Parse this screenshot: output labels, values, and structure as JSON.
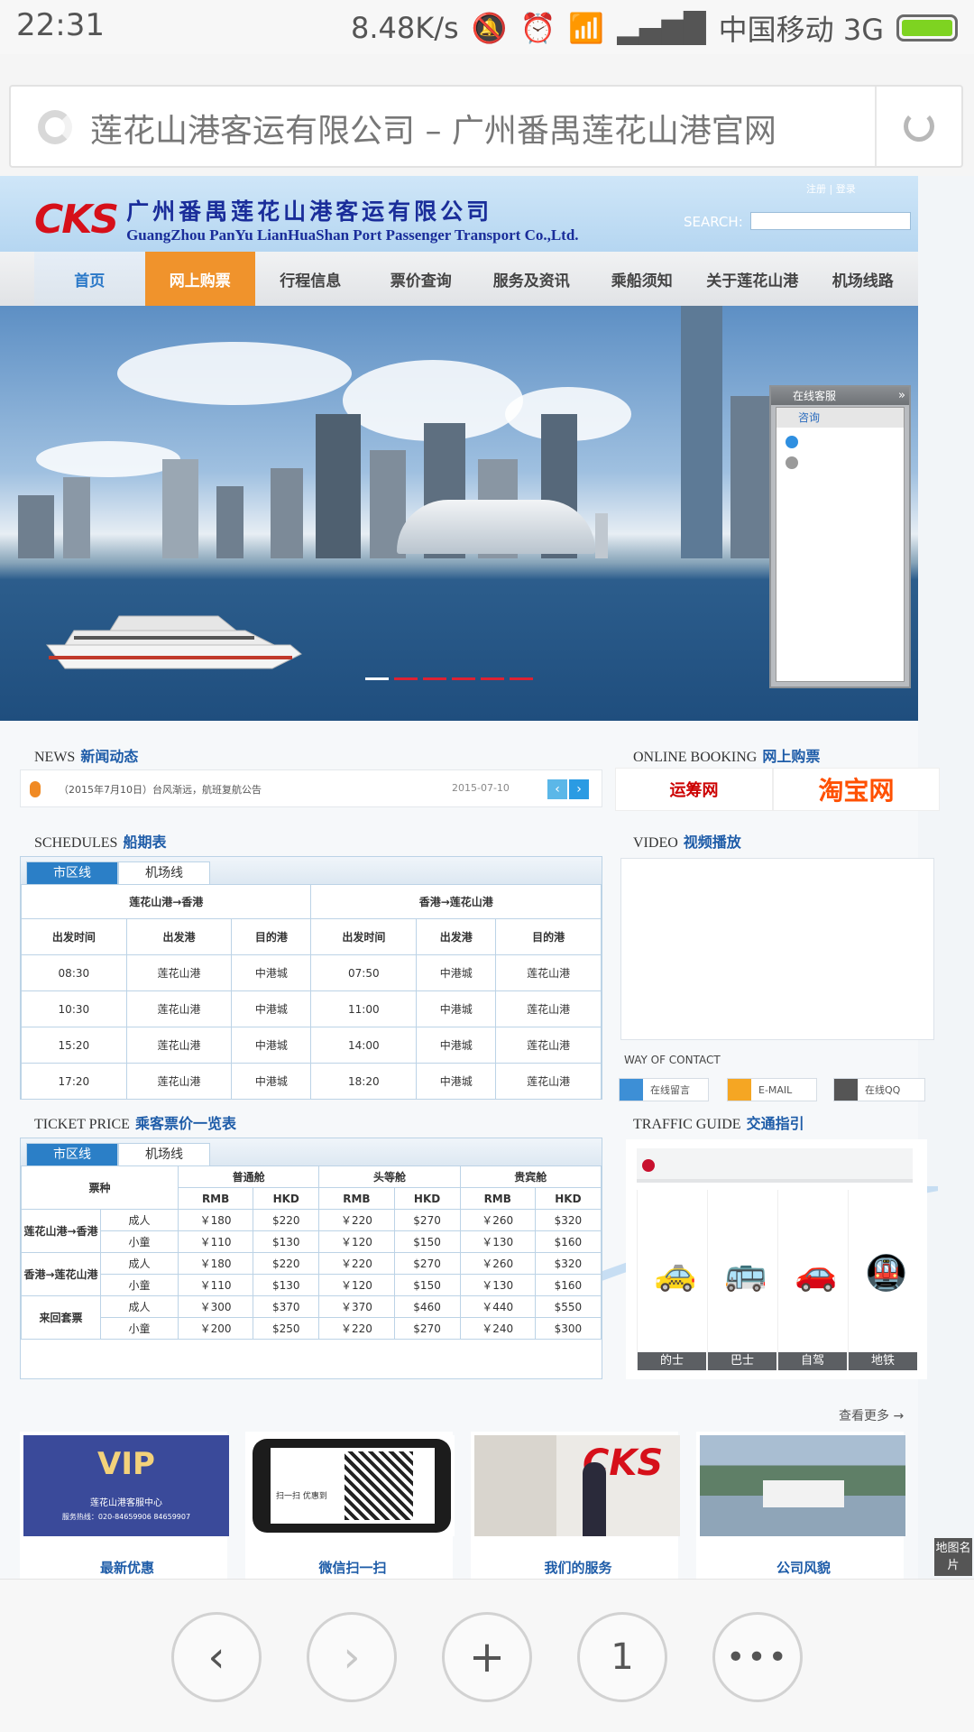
{
  "status_bar": {
    "time": "22:31",
    "speed": "8.48K/s",
    "carrier": "中国移动 3G"
  },
  "browser": {
    "page_title": "莲花山港客运有限公司 – 广州番禺莲花山港官网",
    "tabs_count": "1"
  },
  "site": {
    "logo_mark": "CKS",
    "name_cn": "广州番禺莲花山港客运有限公司",
    "name_en": "GuangZhou PanYu LianHuaShan Port Passenger Transport Co.,Ltd.",
    "login_links": "注册 | 登录",
    "search_label": "SEARCH:",
    "nav": [
      "首页",
      "网上购票",
      "行程信息",
      "票价查询",
      "服务及资讯",
      "乘船须知",
      "关于莲花山港",
      "机场线路"
    ]
  },
  "chat_widget": {
    "title": "在线客服",
    "tab": "咨询"
  },
  "news": {
    "title_en": "NEWS",
    "title_cn": "新闻动态",
    "item": "（2015年7月10日）台风渐远，航班复航公告",
    "date": "2015-07-10"
  },
  "booking": {
    "title_en": "ONLINE BOOKING",
    "title_cn": "网上购票",
    "partner1": "运筹网",
    "partner2": "淘宝网"
  },
  "schedules": {
    "title_en": "SCHEDULES",
    "title_cn": "船期表",
    "tabs": [
      "市区线",
      "机场线"
    ],
    "dir1": "莲花山港→香港",
    "dir2": "香港→莲花山港",
    "headers": [
      "出发时间",
      "出发港",
      "目的港",
      "出发时间",
      "出发港",
      "目的港"
    ],
    "rows": [
      [
        "08:30",
        "莲花山港",
        "中港城",
        "07:50",
        "中港城",
        "莲花山港"
      ],
      [
        "10:30",
        "莲花山港",
        "中港城",
        "11:00",
        "中港城",
        "莲花山港"
      ],
      [
        "15:20",
        "莲花山港",
        "中港城",
        "14:00",
        "中港城",
        "莲花山港"
      ],
      [
        "17:20",
        "莲花山港",
        "中港城",
        "18:20",
        "中港城",
        "莲花山港"
      ]
    ]
  },
  "video": {
    "title_en": "VIDEO",
    "title_cn": "视频播放"
  },
  "contact": {
    "label": "WAY OF CONTACT",
    "buttons": [
      "在线留言",
      "E-MAIL",
      "在线QQ"
    ]
  },
  "prices": {
    "title_en": "TICKET PRICE",
    "title_cn": "乘客票价一览表",
    "tabs": [
      "市区线",
      "机场线"
    ],
    "type_header": "票种",
    "classes": [
      "普通舱",
      "头等舱",
      "贵宾舱"
    ],
    "currencies": [
      "RMB",
      "HKD",
      "RMB",
      "HKD",
      "RMB",
      "HKD"
    ],
    "groups": [
      {
        "route": "莲花山港→香港",
        "rows": [
          {
            "type": "成人",
            "values": [
              "￥180",
              "$220",
              "￥220",
              "$270",
              "￥260",
              "$320"
            ]
          },
          {
            "type": "小童",
            "values": [
              "￥110",
              "$130",
              "￥120",
              "$150",
              "￥130",
              "$160"
            ]
          }
        ]
      },
      {
        "route": "香港→莲花山港",
        "rows": [
          {
            "type": "成人",
            "values": [
              "￥180",
              "$220",
              "￥220",
              "$270",
              "￥260",
              "$320"
            ]
          },
          {
            "type": "小童",
            "values": [
              "￥110",
              "$130",
              "￥120",
              "$150",
              "￥130",
              "$160"
            ]
          }
        ]
      },
      {
        "route": "来回套票",
        "rows": [
          {
            "type": "成人",
            "values": [
              "￥300",
              "$370",
              "￥370",
              "$460",
              "￥440",
              "$550"
            ]
          },
          {
            "type": "小童",
            "values": [
              "￥200",
              "$250",
              "￥220",
              "$270",
              "￥240",
              "$300"
            ]
          }
        ]
      }
    ]
  },
  "traffic": {
    "title_en": "TRAFFIC GUIDE",
    "title_cn": "交通指引",
    "modes": [
      "的士",
      "巴士",
      "自驾",
      "地铁"
    ]
  },
  "more_link": "查看更多 →",
  "thumbs": [
    "最新优惠",
    "微信扫一扫",
    "我们的服务",
    "公司风貌"
  ],
  "vip_card": {
    "badge": "VIP",
    "line": "莲花山港客服中心",
    "hotline": "服务热线：020-84659906  84659907"
  },
  "wechat_card": {
    "text": "扫一扫 优惠到"
  },
  "map_card": "地图名片"
}
